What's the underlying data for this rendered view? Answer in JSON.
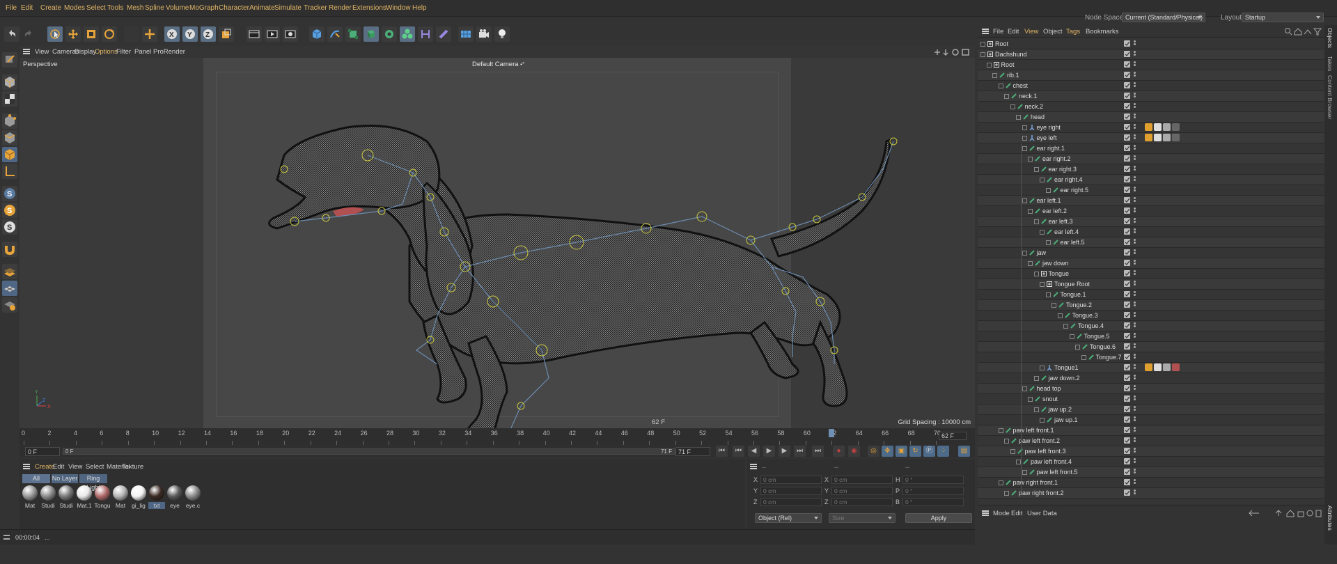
{
  "menu": [
    "File",
    "Edit",
    "Create",
    "Modes",
    "Select",
    "Tools",
    "Mesh",
    "Spline",
    "Volume",
    "MoGraph",
    "Character",
    "Animate",
    "Simulate",
    "Tracker",
    "Render",
    "Extensions",
    "Window",
    "Help"
  ],
  "topright": {
    "node_space_label": "Node Space:",
    "node_space_value": "Current (Standard/Physical)",
    "layout_label": "Layout:",
    "layout_value": "Startup"
  },
  "viewport_menu": [
    "View",
    "Cameras",
    "Display",
    "Options",
    "Filter",
    "Panel",
    "ProRender"
  ],
  "viewport": {
    "name": "Perspective",
    "camera": "Default Camera",
    "frame_label": "62 F",
    "grid_spacing": "Grid Spacing : 10000 cm"
  },
  "timeline": {
    "ticks": [
      "0",
      "2",
      "4",
      "6",
      "8",
      "10",
      "12",
      "14",
      "16",
      "18",
      "20",
      "22",
      "24",
      "26",
      "28",
      "30",
      "32",
      "34",
      "36",
      "38",
      "40",
      "42",
      "44",
      "46",
      "48",
      "50",
      "52",
      "54",
      "56",
      "58",
      "60",
      "62",
      "64",
      "66",
      "68",
      "70"
    ],
    "current_frame": 62,
    "max_frame": 71,
    "frame_field": "62 F"
  },
  "transport": {
    "start": "0 F",
    "min": "0 F",
    "end": "71 F",
    "max": "71 F"
  },
  "material_menu": [
    "Create",
    "Edit",
    "View",
    "Select",
    "Material",
    "Texture"
  ],
  "material_tabs": [
    "All",
    "No Layer",
    "Ring Light"
  ],
  "materials": [
    {
      "name": "Mat",
      "color": "#9a9a9a"
    },
    {
      "name": "Studi",
      "color": "#8c8c8c"
    },
    {
      "name": "Studi",
      "color": "#7a7a7a"
    },
    {
      "name": "Mat.1",
      "color": "#e8e8e8"
    },
    {
      "name": "Tongu",
      "color": "#b06a6a"
    },
    {
      "name": "Mat",
      "color": "#b5b5b5"
    },
    {
      "name": "gi_lig",
      "color": "#f4f4f4"
    },
    {
      "name": "txt",
      "color": "#3a2a22"
    },
    {
      "name": "eye",
      "color": "#5a5a5a"
    },
    {
      "name": "eye.c",
      "color": "#8a8a8a"
    }
  ],
  "coords": {
    "hdr": [
      "--",
      "--",
      "--"
    ],
    "rows": [
      {
        "a": "X",
        "av": "0 cm",
        "b": "X",
        "bv": "0 cm",
        "c": "H",
        "cv": "0 °"
      },
      {
        "a": "Y",
        "av": "0 cm",
        "b": "Y",
        "bv": "0 cm",
        "c": "P",
        "cv": "0 °"
      },
      {
        "a": "Z",
        "av": "0 cm",
        "b": "Z",
        "bv": "0 cm",
        "c": "B",
        "cv": "0 °"
      }
    ],
    "mode": "Object (Rel)",
    "size": "Size",
    "apply": "Apply"
  },
  "status": {
    "time": "00:00:04",
    "msg": "..."
  },
  "object_menu": [
    "File",
    "Edit",
    "View",
    "Object",
    "Tags",
    "Bookmarks"
  ],
  "objects": [
    {
      "name": "Root",
      "depth": 0,
      "icon": "null"
    },
    {
      "name": "Dachshund",
      "depth": 0,
      "icon": "null"
    },
    {
      "name": "Root",
      "depth": 1,
      "icon": "null"
    },
    {
      "name": "rib.1",
      "depth": 2,
      "icon": "joint"
    },
    {
      "name": "chest",
      "depth": 3,
      "icon": "joint"
    },
    {
      "name": "neck.1",
      "depth": 4,
      "icon": "joint"
    },
    {
      "name": "neck.2",
      "depth": 5,
      "icon": "joint"
    },
    {
      "name": "head",
      "depth": 6,
      "icon": "joint"
    },
    {
      "name": "eye right",
      "depth": 7,
      "icon": "ik",
      "tags": [
        "#e0a030",
        "#ddd",
        "#aaa",
        "#666"
      ]
    },
    {
      "name": "eye left",
      "depth": 7,
      "icon": "ik",
      "tags": [
        "#e0a030",
        "#ddd",
        "#aaa",
        "#666"
      ]
    },
    {
      "name": "ear right.1",
      "depth": 7,
      "icon": "joint"
    },
    {
      "name": "ear right.2",
      "depth": 8,
      "icon": "joint"
    },
    {
      "name": "ear right.3",
      "depth": 9,
      "icon": "joint"
    },
    {
      "name": "ear right.4",
      "depth": 10,
      "icon": "joint"
    },
    {
      "name": "ear right.5",
      "depth": 11,
      "icon": "joint"
    },
    {
      "name": "ear left.1",
      "depth": 7,
      "icon": "joint"
    },
    {
      "name": "ear left.2",
      "depth": 8,
      "icon": "joint"
    },
    {
      "name": "ear left.3",
      "depth": 9,
      "icon": "joint"
    },
    {
      "name": "ear left.4",
      "depth": 10,
      "icon": "joint"
    },
    {
      "name": "ear left.5",
      "depth": 11,
      "icon": "joint"
    },
    {
      "name": "jaw",
      "depth": 7,
      "icon": "joint"
    },
    {
      "name": "jaw down",
      "depth": 8,
      "icon": "joint"
    },
    {
      "name": "Tongue",
      "depth": 9,
      "icon": "null"
    },
    {
      "name": "Tongue Root",
      "depth": 10,
      "icon": "null"
    },
    {
      "name": "Tongue.1",
      "depth": 11,
      "icon": "joint"
    },
    {
      "name": "Tongue.2",
      "depth": 12,
      "icon": "joint"
    },
    {
      "name": "Tongue.3",
      "depth": 13,
      "icon": "joint"
    },
    {
      "name": "Tongue.4",
      "depth": 14,
      "icon": "joint"
    },
    {
      "name": "Tongue.5",
      "depth": 15,
      "icon": "joint"
    },
    {
      "name": "Tongue.6",
      "depth": 16,
      "icon": "joint"
    },
    {
      "name": "Tongue.7",
      "depth": 17,
      "icon": "joint"
    },
    {
      "name": "Tongue1",
      "depth": 10,
      "icon": "ik",
      "tags": [
        "#e0a030",
        "#ddd",
        "#aaa",
        "#b05050"
      ]
    },
    {
      "name": "jaw down.2",
      "depth": 9,
      "icon": "joint"
    },
    {
      "name": "head top",
      "depth": 7,
      "icon": "joint"
    },
    {
      "name": "snout",
      "depth": 8,
      "icon": "joint"
    },
    {
      "name": "jaw up.2",
      "depth": 9,
      "icon": "joint"
    },
    {
      "name": "jaw up.1",
      "depth": 10,
      "icon": "joint"
    },
    {
      "name": "paw left front.1",
      "depth": 3,
      "icon": "joint"
    },
    {
      "name": "paw left front.2",
      "depth": 4,
      "icon": "joint"
    },
    {
      "name": "paw left front.3",
      "depth": 5,
      "icon": "joint"
    },
    {
      "name": "paw left front.4",
      "depth": 6,
      "icon": "joint"
    },
    {
      "name": "paw left front.5",
      "depth": 7,
      "icon": "joint"
    },
    {
      "name": "paw right front.1",
      "depth": 3,
      "icon": "joint"
    },
    {
      "name": "paw right front.2",
      "depth": 4,
      "icon": "joint"
    }
  ],
  "attr_menu": [
    "Mode",
    "Edit",
    "User Data"
  ],
  "right_tabs": [
    "Objects",
    "Takes",
    "Content Browser",
    "Attributes"
  ],
  "colors": {
    "accent": "#5d7390",
    "joint": "#4caf7a",
    "menu_text": "#e1b566"
  }
}
